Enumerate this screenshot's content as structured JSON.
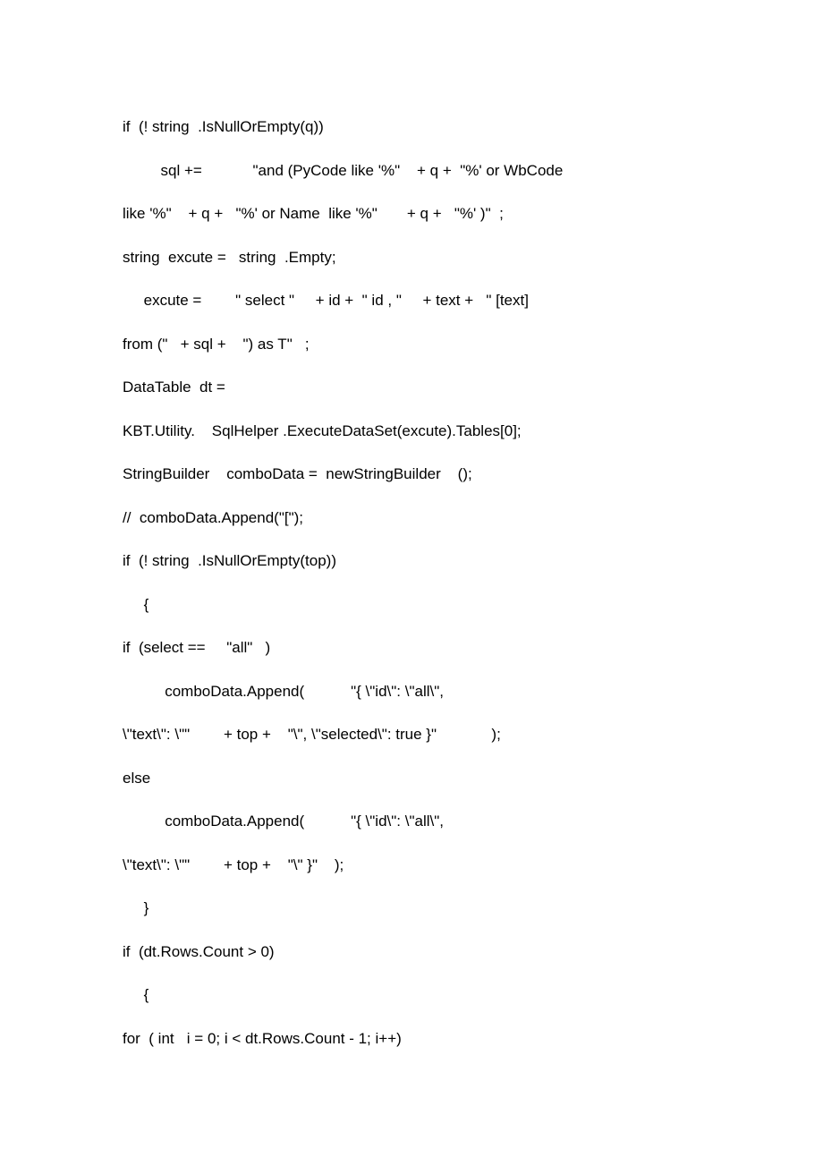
{
  "document": {
    "page_background": "#ffffff",
    "text_color": "#000000",
    "code_listing": {
      "language": "csharp",
      "lines": [
        "if  (! string  .IsNullOrEmpty(q))",
        "         sql +=            \"and (PyCode like '%\"    + q +  \"%' or WbCode",
        "like '%\"    + q +   \"%' or Name  like '%\"       + q +   \"%' )\"  ;",
        "string  excute =   string  .Empty;",
        "     excute =        \" select \"     + id +  \" id , \"     + text +   \" [text]",
        "from (\"   + sql +    \") as T\"   ;",
        "DataTable  dt =",
        "KBT.Utility.    SqlHelper .ExecuteDataSet(excute).Tables[0];",
        "StringBuilder    comboData =  newStringBuilder    ();",
        "//  comboData.Append(\"[\");",
        "if  (! string  .IsNullOrEmpty(top))",
        "     {",
        "if  (select ==     \"all\"   )",
        "          comboData.Append(           \"{ \\\"id\\\": \\\"all\\\",",
        "\\\"text\\\": \\\"\"        + top +    \"\\\", \\\"selected\\\": true }\"             );",
        "else",
        "          comboData.Append(           \"{ \\\"id\\\": \\\"all\\\",",
        "\\\"text\\\": \\\"\"        + top +    \"\\\" }\"    );",
        "     }",
        "if  (dt.Rows.Count > 0)",
        "     {",
        "for  ( int   i = 0; i < dt.Rows.Count - 1; i++)"
      ]
    }
  }
}
